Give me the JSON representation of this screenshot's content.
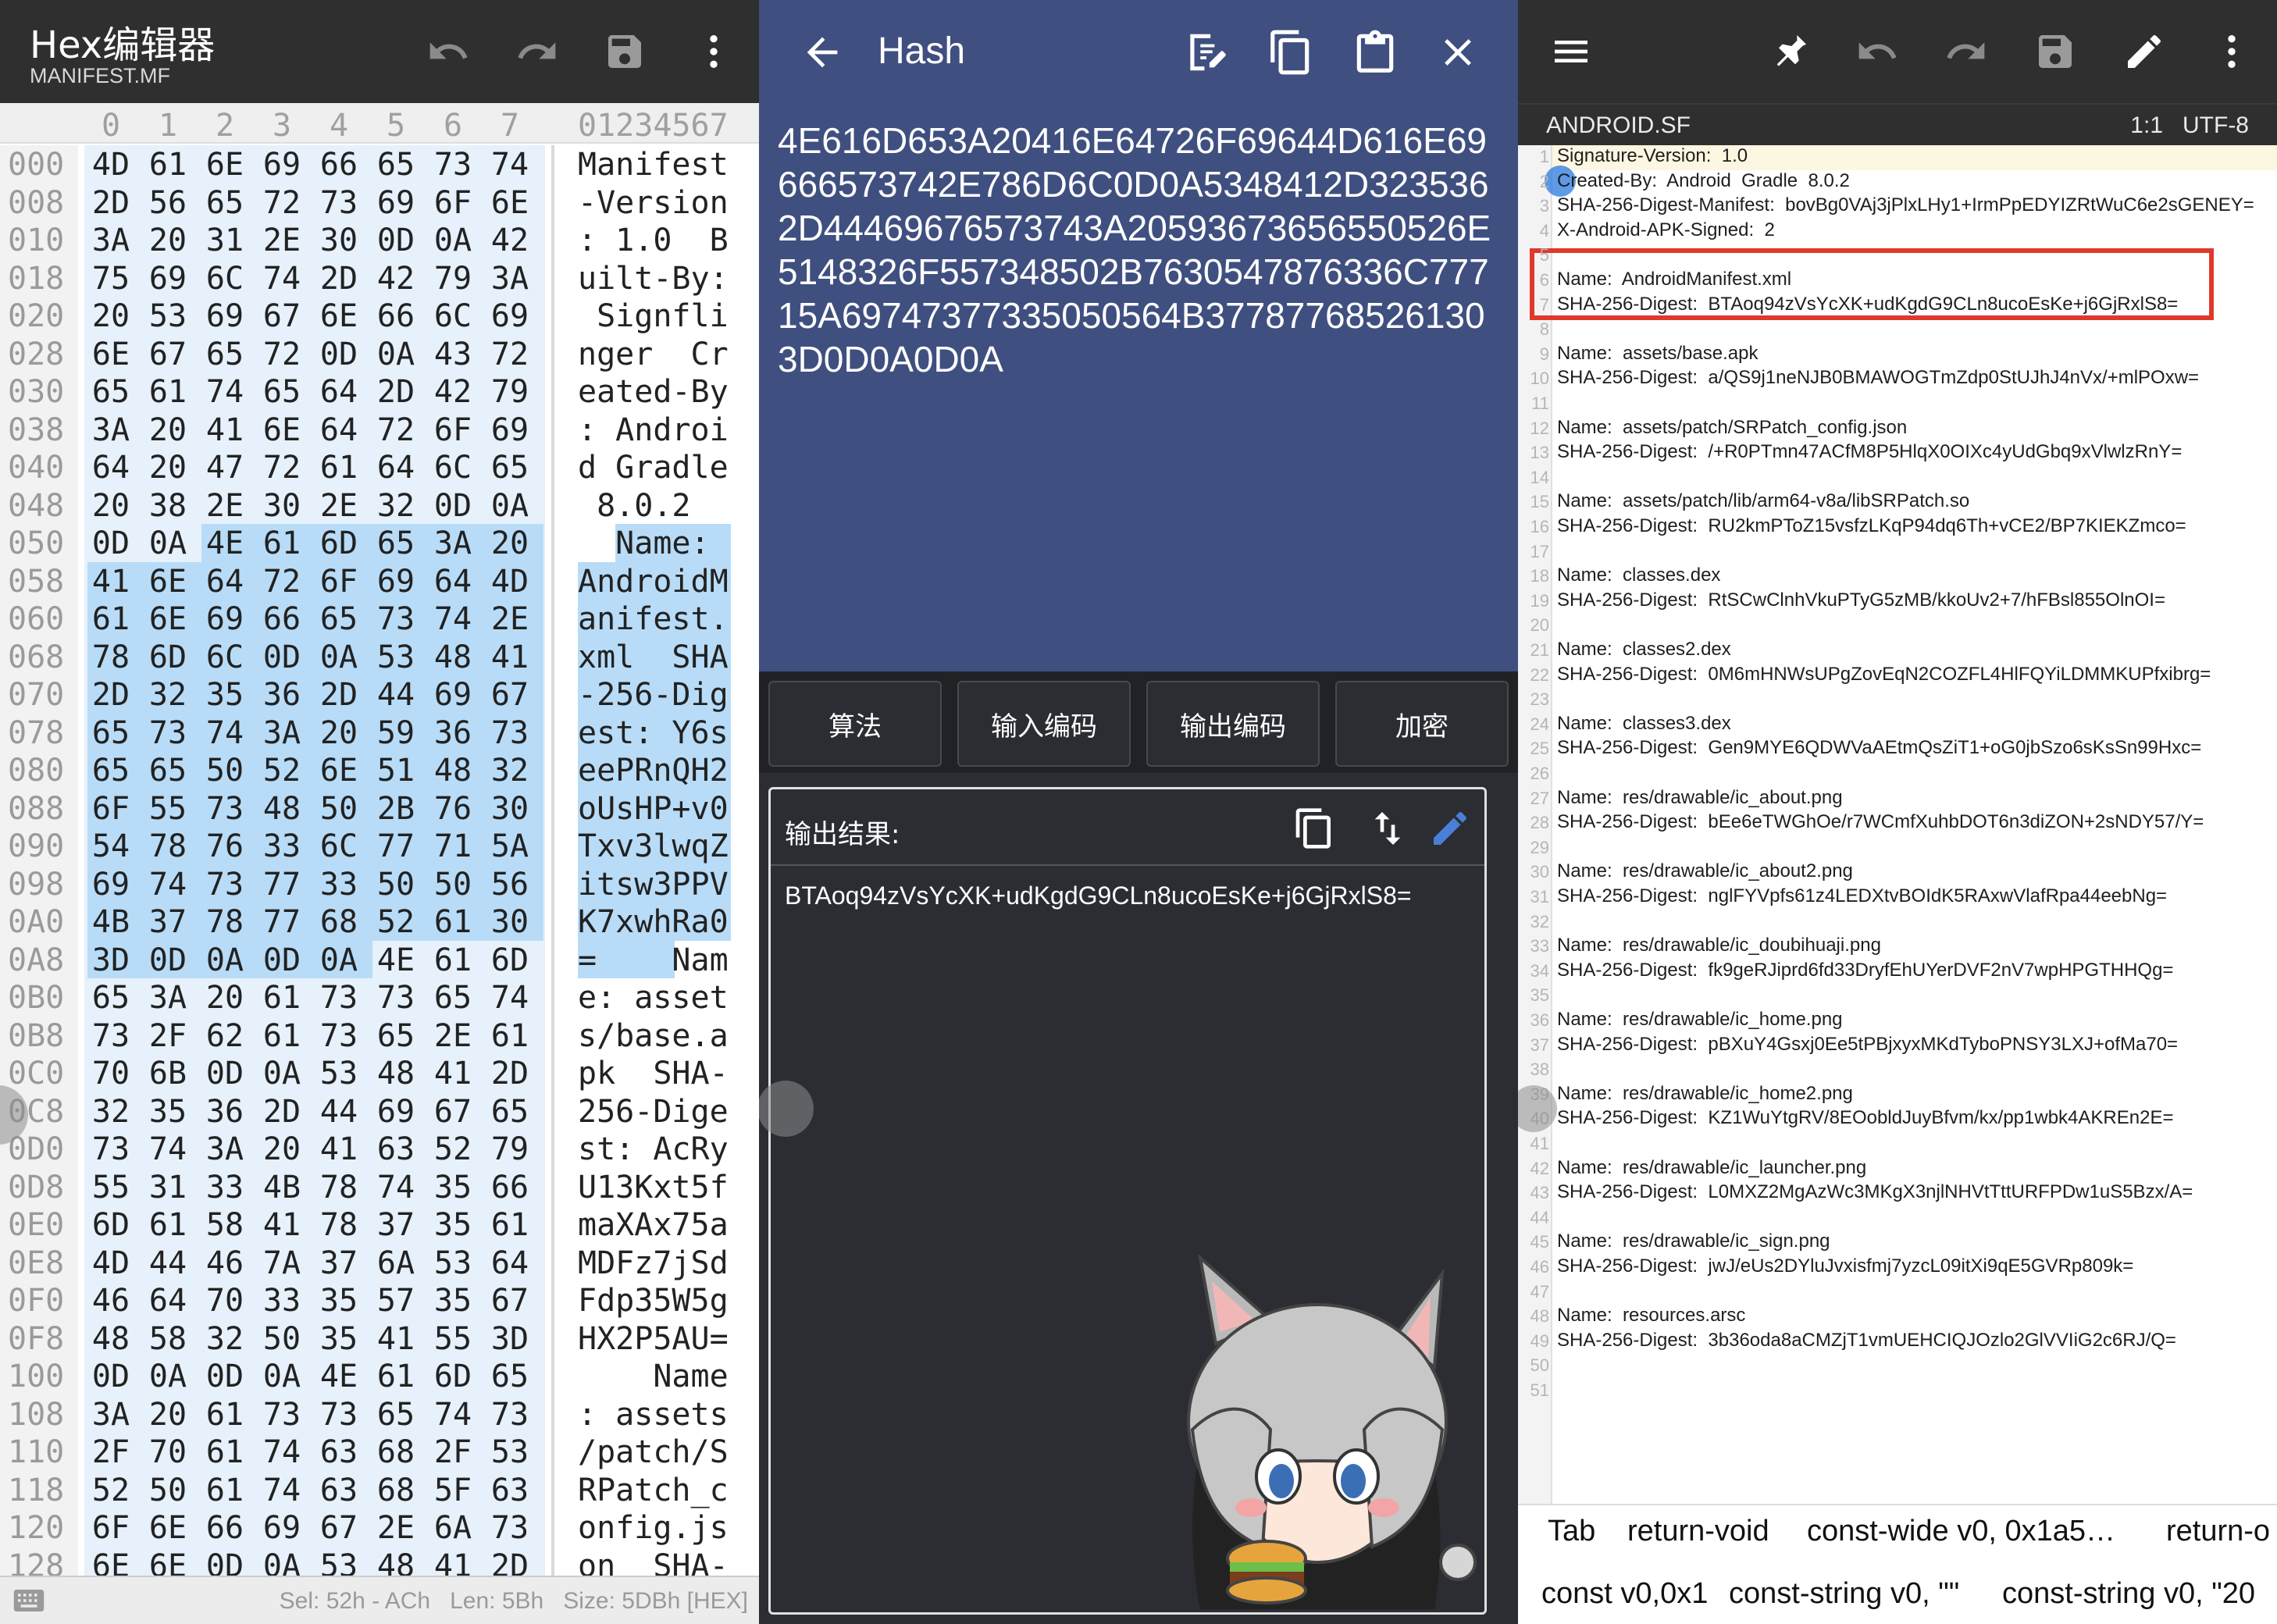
{
  "hex_editor": {
    "title": "Hex编辑器",
    "subtitle": "MANIFEST.MF",
    "icons": [
      "undo-icon",
      "redo-icon",
      "save-icon",
      "more-vert-icon"
    ],
    "column_digits": [
      "0",
      "1",
      "2",
      "3",
      "4",
      "5",
      "6",
      "7"
    ],
    "ascii_header": "01234567",
    "rows": [
      {
        "addr": "000",
        "bytes": [
          "4D",
          "61",
          "6E",
          "69",
          "66",
          "65",
          "73",
          "74"
        ],
        "ascii": "Manifest"
      },
      {
        "addr": "008",
        "bytes": [
          "2D",
          "56",
          "65",
          "72",
          "73",
          "69",
          "6F",
          "6E"
        ],
        "ascii": "-Version"
      },
      {
        "addr": "010",
        "bytes": [
          "3A",
          "20",
          "31",
          "2E",
          "30",
          "0D",
          "0A",
          "42"
        ],
        "ascii": ": 1.0  B"
      },
      {
        "addr": "018",
        "bytes": [
          "75",
          "69",
          "6C",
          "74",
          "2D",
          "42",
          "79",
          "3A"
        ],
        "ascii": "uilt-By:"
      },
      {
        "addr": "020",
        "bytes": [
          "20",
          "53",
          "69",
          "67",
          "6E",
          "66",
          "6C",
          "69"
        ],
        "ascii": " Signfli"
      },
      {
        "addr": "028",
        "bytes": [
          "6E",
          "67",
          "65",
          "72",
          "0D",
          "0A",
          "43",
          "72"
        ],
        "ascii": "nger  Cr"
      },
      {
        "addr": "030",
        "bytes": [
          "65",
          "61",
          "74",
          "65",
          "64",
          "2D",
          "42",
          "79"
        ],
        "ascii": "eated-By"
      },
      {
        "addr": "038",
        "bytes": [
          "3A",
          "20",
          "41",
          "6E",
          "64",
          "72",
          "6F",
          "69"
        ],
        "ascii": ": Androi"
      },
      {
        "addr": "040",
        "bytes": [
          "64",
          "20",
          "47",
          "72",
          "61",
          "64",
          "6C",
          "65"
        ],
        "ascii": "d Gradle"
      },
      {
        "addr": "048",
        "bytes": [
          "20",
          "38",
          "2E",
          "30",
          "2E",
          "32",
          "0D",
          "0A"
        ],
        "ascii": " 8.0.2  "
      },
      {
        "addr": "050",
        "bytes": [
          "0D",
          "0A",
          "4E",
          "61",
          "6D",
          "65",
          "3A",
          "20"
        ],
        "ascii": "  Name: "
      },
      {
        "addr": "058",
        "bytes": [
          "41",
          "6E",
          "64",
          "72",
          "6F",
          "69",
          "64",
          "4D"
        ],
        "ascii": "AndroidM"
      },
      {
        "addr": "060",
        "bytes": [
          "61",
          "6E",
          "69",
          "66",
          "65",
          "73",
          "74",
          "2E"
        ],
        "ascii": "anifest."
      },
      {
        "addr": "068",
        "bytes": [
          "78",
          "6D",
          "6C",
          "0D",
          "0A",
          "53",
          "48",
          "41"
        ],
        "ascii": "xml  SHA"
      },
      {
        "addr": "070",
        "bytes": [
          "2D",
          "32",
          "35",
          "36",
          "2D",
          "44",
          "69",
          "67"
        ],
        "ascii": "-256-Dig"
      },
      {
        "addr": "078",
        "bytes": [
          "65",
          "73",
          "74",
          "3A",
          "20",
          "59",
          "36",
          "73"
        ],
        "ascii": "est: Y6s"
      },
      {
        "addr": "080",
        "bytes": [
          "65",
          "65",
          "50",
          "52",
          "6E",
          "51",
          "48",
          "32"
        ],
        "ascii": "eePRnQH2"
      },
      {
        "addr": "088",
        "bytes": [
          "6F",
          "55",
          "73",
          "48",
          "50",
          "2B",
          "76",
          "30"
        ],
        "ascii": "oUsHP+v0"
      },
      {
        "addr": "090",
        "bytes": [
          "54",
          "78",
          "76",
          "33",
          "6C",
          "77",
          "71",
          "5A"
        ],
        "ascii": "Txv3lwqZ"
      },
      {
        "addr": "098",
        "bytes": [
          "69",
          "74",
          "73",
          "77",
          "33",
          "50",
          "50",
          "56"
        ],
        "ascii": "itsw3PPV"
      },
      {
        "addr": "0A0",
        "bytes": [
          "4B",
          "37",
          "78",
          "77",
          "68",
          "52",
          "61",
          "30"
        ],
        "ascii": "K7xwhRa0"
      },
      {
        "addr": "0A8",
        "bytes": [
          "3D",
          "0D",
          "0A",
          "0D",
          "0A",
          "4E",
          "61",
          "6D"
        ],
        "ascii": "=    Nam"
      },
      {
        "addr": "0B0",
        "bytes": [
          "65",
          "3A",
          "20",
          "61",
          "73",
          "73",
          "65",
          "74"
        ],
        "ascii": "e: asset"
      },
      {
        "addr": "0B8",
        "bytes": [
          "73",
          "2F",
          "62",
          "61",
          "73",
          "65",
          "2E",
          "61"
        ],
        "ascii": "s/base.a"
      },
      {
        "addr": "0C0",
        "bytes": [
          "70",
          "6B",
          "0D",
          "0A",
          "53",
          "48",
          "41",
          "2D"
        ],
        "ascii": "pk  SHA-"
      },
      {
        "addr": "0C8",
        "bytes": [
          "32",
          "35",
          "36",
          "2D",
          "44",
          "69",
          "67",
          "65"
        ],
        "ascii": "256-Dige"
      },
      {
        "addr": "0D0",
        "bytes": [
          "73",
          "74",
          "3A",
          "20",
          "41",
          "63",
          "52",
          "79"
        ],
        "ascii": "st: AcRy"
      },
      {
        "addr": "0D8",
        "bytes": [
          "55",
          "31",
          "33",
          "4B",
          "78",
          "74",
          "35",
          "66"
        ],
        "ascii": "U13Kxt5f"
      },
      {
        "addr": "0E0",
        "bytes": [
          "6D",
          "61",
          "58",
          "41",
          "78",
          "37",
          "35",
          "61"
        ],
        "ascii": "maXAx75a"
      },
      {
        "addr": "0E8",
        "bytes": [
          "4D",
          "44",
          "46",
          "7A",
          "37",
          "6A",
          "53",
          "64"
        ],
        "ascii": "MDFz7jSd"
      },
      {
        "addr": "0F0",
        "bytes": [
          "46",
          "64",
          "70",
          "33",
          "35",
          "57",
          "35",
          "67"
        ],
        "ascii": "Fdp35W5g"
      },
      {
        "addr": "0F8",
        "bytes": [
          "48",
          "58",
          "32",
          "50",
          "35",
          "41",
          "55",
          "3D"
        ],
        "ascii": "HX2P5AU="
      },
      {
        "addr": "100",
        "bytes": [
          "0D",
          "0A",
          "0D",
          "0A",
          "4E",
          "61",
          "6D",
          "65"
        ],
        "ascii": "    Name"
      },
      {
        "addr": "108",
        "bytes": [
          "3A",
          "20",
          "61",
          "73",
          "73",
          "65",
          "74",
          "73"
        ],
        "ascii": ": assets"
      },
      {
        "addr": "110",
        "bytes": [
          "2F",
          "70",
          "61",
          "74",
          "63",
          "68",
          "2F",
          "53"
        ],
        "ascii": "/patch/S"
      },
      {
        "addr": "118",
        "bytes": [
          "52",
          "50",
          "61",
          "74",
          "63",
          "68",
          "5F",
          "63"
        ],
        "ascii": "RPatch_c"
      },
      {
        "addr": "120",
        "bytes": [
          "6F",
          "6E",
          "66",
          "69",
          "67",
          "2E",
          "6A",
          "73"
        ],
        "ascii": "onfig.js"
      },
      {
        "addr": "128",
        "bytes": [
          "6E",
          "6E",
          "0D",
          "0A",
          "53",
          "48",
          "41",
          "2D"
        ],
        "ascii": "on  SHA-"
      }
    ],
    "status": "Sel: 52h - ACh   Len: 5Bh   Size: 5DBh [HEX]"
  },
  "hash_tool": {
    "title": "Hash",
    "icons": [
      "back-arrow-icon",
      "edit-document-icon",
      "copy-icon",
      "paste-icon",
      "close-icon"
    ],
    "hex_input": "4E616D653A20416E64726F69644D616E69666573742E786D6C0D0A5348412D3235362D4469676573743A2059367365655052 6E5148326F557348502B7630547876336C77715A69747377335050564B377877685261303D0D0A0D0A",
    "hex_display": "4E616D653A20416E64726F69644D616E69666573742E786D6C0D0A5348412D3235362D44469676573743A20593673656550526E5148326F557348502B7630547876336C77715A69747377335050564B377877685261303D0D0A0D0A",
    "tabs": [
      "算法",
      "输入编码",
      "输出编码",
      "加密"
    ],
    "output_label": "输出结果:",
    "output_value": "BTAoq94zVsYcXK+udKgdG9CLn8ucoEsKe+j6GjRxlS8=",
    "output_icons": [
      "copy-icon",
      "swap-icon",
      "edit-icon"
    ]
  },
  "text_editor": {
    "icons": [
      "menu-icon",
      "pin-icon",
      "undo-icon",
      "redo-icon",
      "save-icon",
      "pencil-icon",
      "more-vert-icon"
    ],
    "file_name": "ANDROID.SF",
    "position": "1:1   UTF-8",
    "lines": [
      {
        "n": "1",
        "t": "Signature-Version:  1.0"
      },
      {
        "n": "2",
        "t": "Created-By:  Android  Gradle  8.0.2"
      },
      {
        "n": "3",
        "t": "SHA-256-Digest-Manifest:  bovBg0VAj3jPlxLHy1+IrmPpEDYIZRtWuC6e2sGENEY="
      },
      {
        "n": "4",
        "t": "X-Android-APK-Signed:  2"
      },
      {
        "n": "5",
        "t": ""
      },
      {
        "n": "6",
        "t": "Name:  AndroidManifest.xml"
      },
      {
        "n": "7",
        "t": "SHA-256-Digest:  BTAoq94zVsYcXK+udKgdG9CLn8ucoEsKe+j6GjRxlS8="
      },
      {
        "n": "8",
        "t": ""
      },
      {
        "n": "9",
        "t": "Name:  assets/base.apk"
      },
      {
        "n": "10",
        "t": "SHA-256-Digest:  a/QS9j1neNJB0BMAWOGTmZdp0StUJhJ4nVx/+mlPOxw="
      },
      {
        "n": "11",
        "t": ""
      },
      {
        "n": "12",
        "t": "Name:  assets/patch/SRPatch_config.json"
      },
      {
        "n": "13",
        "t": "SHA-256-Digest:  /+R0PTmn47ACfM8P5HlqX0OIXc4yUdGbq9xVlwlzRnY="
      },
      {
        "n": "14",
        "t": ""
      },
      {
        "n": "15",
        "t": "Name:  assets/patch/lib/arm64-v8a/libSRPatch.so"
      },
      {
        "n": "16",
        "t": "SHA-256-Digest:  RU2kmPToZ15vsfzLKqP94dq6Th+vCE2/BP7KIEKZmco="
      },
      {
        "n": "17",
        "t": ""
      },
      {
        "n": "18",
        "t": "Name:  classes.dex"
      },
      {
        "n": "19",
        "t": "SHA-256-Digest:  RtSCwClnhVkuPTyG5zMB/kkoUv2+7/hFBsl855OlnOI="
      },
      {
        "n": "20",
        "t": ""
      },
      {
        "n": "21",
        "t": "Name:  classes2.dex"
      },
      {
        "n": "22",
        "t": "SHA-256-Digest:  0M6mHNWsUPgZovEqN2COZFL4HlFQYiLDMMKUPfxibrg="
      },
      {
        "n": "23",
        "t": ""
      },
      {
        "n": "24",
        "t": "Name:  classes3.dex"
      },
      {
        "n": "25",
        "t": "SHA-256-Digest:  Gen9MYE6QDWVaAEtmQsZiT1+oG0jbSzo6sKsSn99Hxc="
      },
      {
        "n": "26",
        "t": ""
      },
      {
        "n": "27",
        "t": "Name:  res/drawable/ic_about.png"
      },
      {
        "n": "28",
        "t": "SHA-256-Digest:  bEe6eTWGhOe/r7WCmfXuhbDOT6n3diZON+2sNDY57/Y="
      },
      {
        "n": "29",
        "t": ""
      },
      {
        "n": "30",
        "t": "Name:  res/drawable/ic_about2.png"
      },
      {
        "n": "31",
        "t": "SHA-256-Digest:  nglFYVpfs61z4LEDXtvBOIdK5RAxwVlafRpa44eebNg="
      },
      {
        "n": "32",
        "t": ""
      },
      {
        "n": "33",
        "t": "Name:  res/drawable/ic_doubihuaji.png"
      },
      {
        "n": "34",
        "t": "SHA-256-Digest:  fk9geRJiprd6fd33DryfEhUYerDVF2nV7wpHPGTHHQg="
      },
      {
        "n": "35",
        "t": ""
      },
      {
        "n": "36",
        "t": "Name:  res/drawable/ic_home.png"
      },
      {
        "n": "37",
        "t": "SHA-256-Digest:  pBXuY4Gsxj0Ee5tPBjxyxMKdTyboPNSY3LXJ+ofMa70="
      },
      {
        "n": "38",
        "t": ""
      },
      {
        "n": "39",
        "t": "Name:  res/drawable/ic_home2.png"
      },
      {
        "n": "40",
        "t": "SHA-256-Digest:  KZ1WuYtgRV/8EOobldJuyBfvm/kx/pp1wbk4AKREn2E="
      },
      {
        "n": "41",
        "t": ""
      },
      {
        "n": "42",
        "t": "Name:  res/drawable/ic_launcher.png"
      },
      {
        "n": "43",
        "t": "SHA-256-Digest:  L0MXZ2MgAzWc3MKgX3njlNHVtTttURFPDw1uS5Bzx/A="
      },
      {
        "n": "44",
        "t": ""
      },
      {
        "n": "45",
        "t": "Name:  res/drawable/ic_sign.png"
      },
      {
        "n": "46",
        "t": "SHA-256-Digest:  jwJ/eUs2DYluJvxisfmj7yzcL09itXi9qE5GVRp809k="
      },
      {
        "n": "47",
        "t": ""
      },
      {
        "n": "48",
        "t": "Name:  resources.arsc"
      },
      {
        "n": "49",
        "t": "SHA-256-Digest:  3b36oda8aCMZjT1vmUEHCIQJOzlo2GlVVIiG2c6RJ/Q="
      },
      {
        "n": "50",
        "t": ""
      },
      {
        "n": "51",
        "t": ""
      }
    ],
    "suggestions_row1": [
      "Tab",
      "return-void",
      "const-wide v0, 0x1a5…",
      "return-o"
    ],
    "suggestions_row2": [
      "const v0,0x1",
      "const-string v0, \"\"",
      "const-string v0, \"20"
    ]
  },
  "colors": {
    "hex_selection": "#b8dcf7",
    "hash_header": "#3f4f7f",
    "highlight_box": "#e0382a"
  }
}
